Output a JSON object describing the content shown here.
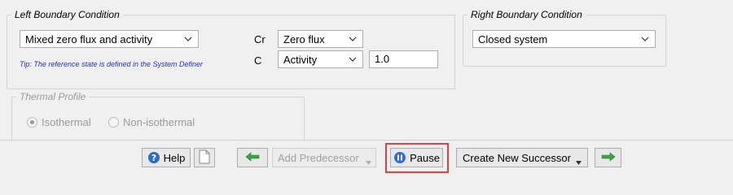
{
  "left_boundary": {
    "title": "Left Boundary Condition",
    "type_value": "Mixed zero flux and activity",
    "tip": "Tip: The reference state is defined in the System Definer",
    "rows": [
      {
        "label": "Cr",
        "type": "Zero flux",
        "value": ""
      },
      {
        "label": "C",
        "type": "Activity",
        "value": "1.0"
      }
    ]
  },
  "right_boundary": {
    "title": "Right Boundary Condition",
    "type_value": "Closed system"
  },
  "thermal_profile": {
    "title": "Thermal Profile",
    "options": [
      "Isothermal",
      "Non-isothermal"
    ],
    "selected": "Isothermal",
    "enabled": false
  },
  "toolbar": {
    "help_label": "Help",
    "add_predecessor_label": "Add Predecessor",
    "pause_label": "Pause",
    "create_successor_label": "Create New Successor",
    "colors": {
      "highlight": "#e0403e",
      "arrow_green": "#3aa640",
      "pause_blue": "#2f6fd0",
      "help_blue": "#2d6cc4"
    },
    "icons": [
      "help-icon",
      "document-icon",
      "arrow-left-icon",
      "pause-icon",
      "arrow-right-icon"
    ]
  }
}
